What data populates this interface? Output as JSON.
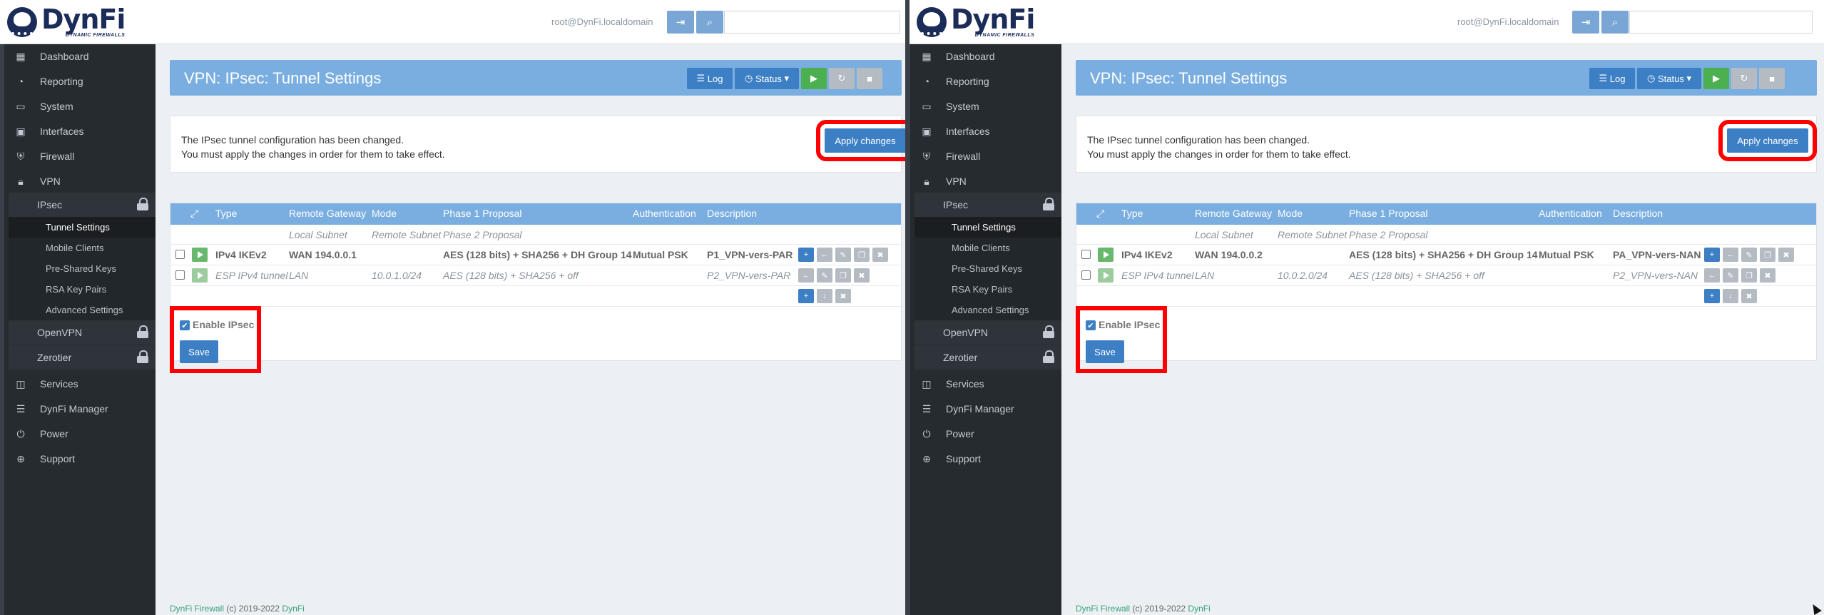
{
  "header": {
    "logo_name": "DynFi",
    "logo_tag": "DYNAMIC FIREWALLS",
    "user": "root@DynFi.localdomain",
    "logout_icon": "sign-out-icon",
    "search_icon": "search-icon",
    "search_placeholder": ""
  },
  "sidebar": {
    "items": [
      {
        "label": "Dashboard",
        "icon": "grid-icon"
      },
      {
        "label": "Reporting",
        "icon": "pie-chart-icon"
      },
      {
        "label": "System",
        "icon": "monitor-icon"
      },
      {
        "label": "Interfaces",
        "icon": "laptop-icon"
      },
      {
        "label": "Firewall",
        "icon": "shield-icon"
      },
      {
        "label": "VPN",
        "icon": "lock-icon"
      },
      {
        "label": "Services",
        "icon": "services-icon"
      },
      {
        "label": "DynFi Manager",
        "icon": "server-icon"
      },
      {
        "label": "Power",
        "icon": "power-icon"
      },
      {
        "label": "Support",
        "icon": "lifebuoy-icon"
      }
    ],
    "vpn_children": [
      {
        "label": "IPsec",
        "locked": true
      },
      {
        "label": "OpenVPN",
        "locked": true
      },
      {
        "label": "Zerotier",
        "locked": true
      }
    ],
    "ipsec_children": [
      "Tunnel Settings",
      "Mobile Clients",
      "Pre-Shared Keys",
      "RSA Key Pairs",
      "Advanced Settings"
    ]
  },
  "main": {
    "title": "VPN: IPsec: Tunnel Settings",
    "buttons": {
      "log": "Log",
      "status": "Status"
    },
    "notice": {
      "line1": "The IPsec tunnel configuration has been changed.",
      "line2": "You must apply the changes in order for them to take effect.",
      "apply": "Apply changes"
    },
    "table": {
      "headers": [
        "Type",
        "Remote Gateway",
        "Mode",
        "Phase 1 Proposal",
        "Authentication",
        "Description"
      ],
      "subheaders": [
        "Local Subnet",
        "Remote Subnet",
        "Phase 2 Proposal"
      ]
    },
    "enable_label": "Enable IPsec",
    "save": "Save",
    "footer": {
      "brand": "DynFi Firewall",
      "copy": "(c) 2019-2022",
      "link": "DynFi"
    }
  },
  "left": {
    "phase1": {
      "type": "IPv4 IKEv2",
      "gateway": "WAN 194.0.0.1",
      "proposal": "AES (128 bits) + SHA256 + DH Group 14",
      "auth": "Mutual PSK",
      "desc": "P1_VPN-vers-PAR"
    },
    "phase2": {
      "type": "ESP IPv4 tunnel",
      "local": "LAN",
      "remote": "10.0.1.0/24",
      "proposal": "AES (128 bits) + SHA256 + off",
      "desc": "P2_VPN-vers-PAR"
    }
  },
  "right": {
    "phase1": {
      "type": "IPv4 IKEv2",
      "gateway": "WAN 194.0.0.2",
      "proposal": "AES (128 bits) + SHA256 + DH Group 14",
      "auth": "Mutual PSK",
      "desc": "PA_VPN-vers-NAN"
    },
    "phase2": {
      "type": "ESP IPv4 tunnel",
      "local": "LAN",
      "remote": "10.0.2.0/24",
      "proposal": "AES (128 bits) + SHA256 + off",
      "desc": "P2_VPN-vers-NAN"
    }
  }
}
